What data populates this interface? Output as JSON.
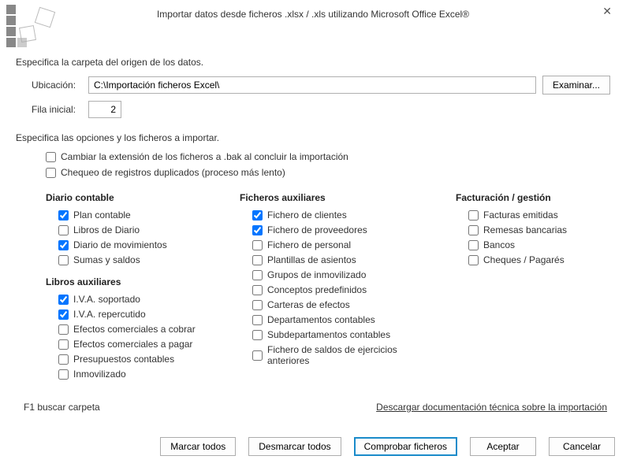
{
  "title": "Importar datos desde ficheros .xlsx / .xls utilizando Microsoft Office Excel®",
  "section1_label": "Especifica la carpeta del origen de los datos.",
  "location_label": "Ubicación:",
  "location_value": "C:\\Importación ficheros Excel\\",
  "browse_label": "Examinar...",
  "row_label": "Fila inicial:",
  "row_value": "2",
  "section2_label": "Especifica las opciones y los ficheros a importar.",
  "top_opts": [
    {
      "label": "Cambiar la extensión de los ficheros a .bak al concluir la importación",
      "checked": false
    },
    {
      "label": "Chequeo de registros duplicados (proceso más lento)",
      "checked": false
    }
  ],
  "col1": {
    "g1_heading": "Diario contable",
    "g1_items": [
      {
        "label": "Plan contable",
        "checked": true
      },
      {
        "label": "Libros de Diario",
        "checked": false
      },
      {
        "label": "Diario de movimientos",
        "checked": true
      },
      {
        "label": "Sumas y saldos",
        "checked": false
      }
    ],
    "g2_heading": "Libros auxiliares",
    "g2_items": [
      {
        "label": "I.V.A. soportado",
        "checked": true
      },
      {
        "label": "I.V.A. repercutido",
        "checked": true
      },
      {
        "label": "Efectos comerciales a cobrar",
        "checked": false
      },
      {
        "label": "Efectos comerciales a pagar",
        "checked": false
      },
      {
        "label": "Presupuestos contables",
        "checked": false
      },
      {
        "label": "Inmovilizado",
        "checked": false
      }
    ]
  },
  "col2": {
    "heading": "Ficheros auxiliares",
    "items": [
      {
        "label": "Fichero de clientes",
        "checked": true
      },
      {
        "label": "Fichero de proveedores",
        "checked": true
      },
      {
        "label": "Fichero de personal",
        "checked": false
      },
      {
        "label": "Plantillas de asientos",
        "checked": false
      },
      {
        "label": "Grupos de inmovilizado",
        "checked": false
      },
      {
        "label": "Conceptos predefinidos",
        "checked": false
      },
      {
        "label": "Carteras de efectos",
        "checked": false
      },
      {
        "label": "Departamentos contables",
        "checked": false
      },
      {
        "label": "Subdepartamentos contables",
        "checked": false
      },
      {
        "label": "Fichero de saldos de ejercicios anteriores",
        "checked": false
      }
    ]
  },
  "col3": {
    "heading": "Facturación / gestión",
    "items": [
      {
        "label": "Facturas emitidas",
        "checked": false
      },
      {
        "label": "Remesas bancarias",
        "checked": false
      },
      {
        "label": "Bancos",
        "checked": false
      },
      {
        "label": "Cheques / Pagarés",
        "checked": false
      }
    ]
  },
  "footer_hint": "F1 buscar carpeta",
  "doc_link": "Descargar documentación técnica sobre la importación",
  "buttons": {
    "mark_all": "Marcar todos",
    "unmark_all": "Desmarcar todos",
    "check_files": "Comprobar ficheros",
    "ok": "Aceptar",
    "cancel": "Cancelar"
  }
}
